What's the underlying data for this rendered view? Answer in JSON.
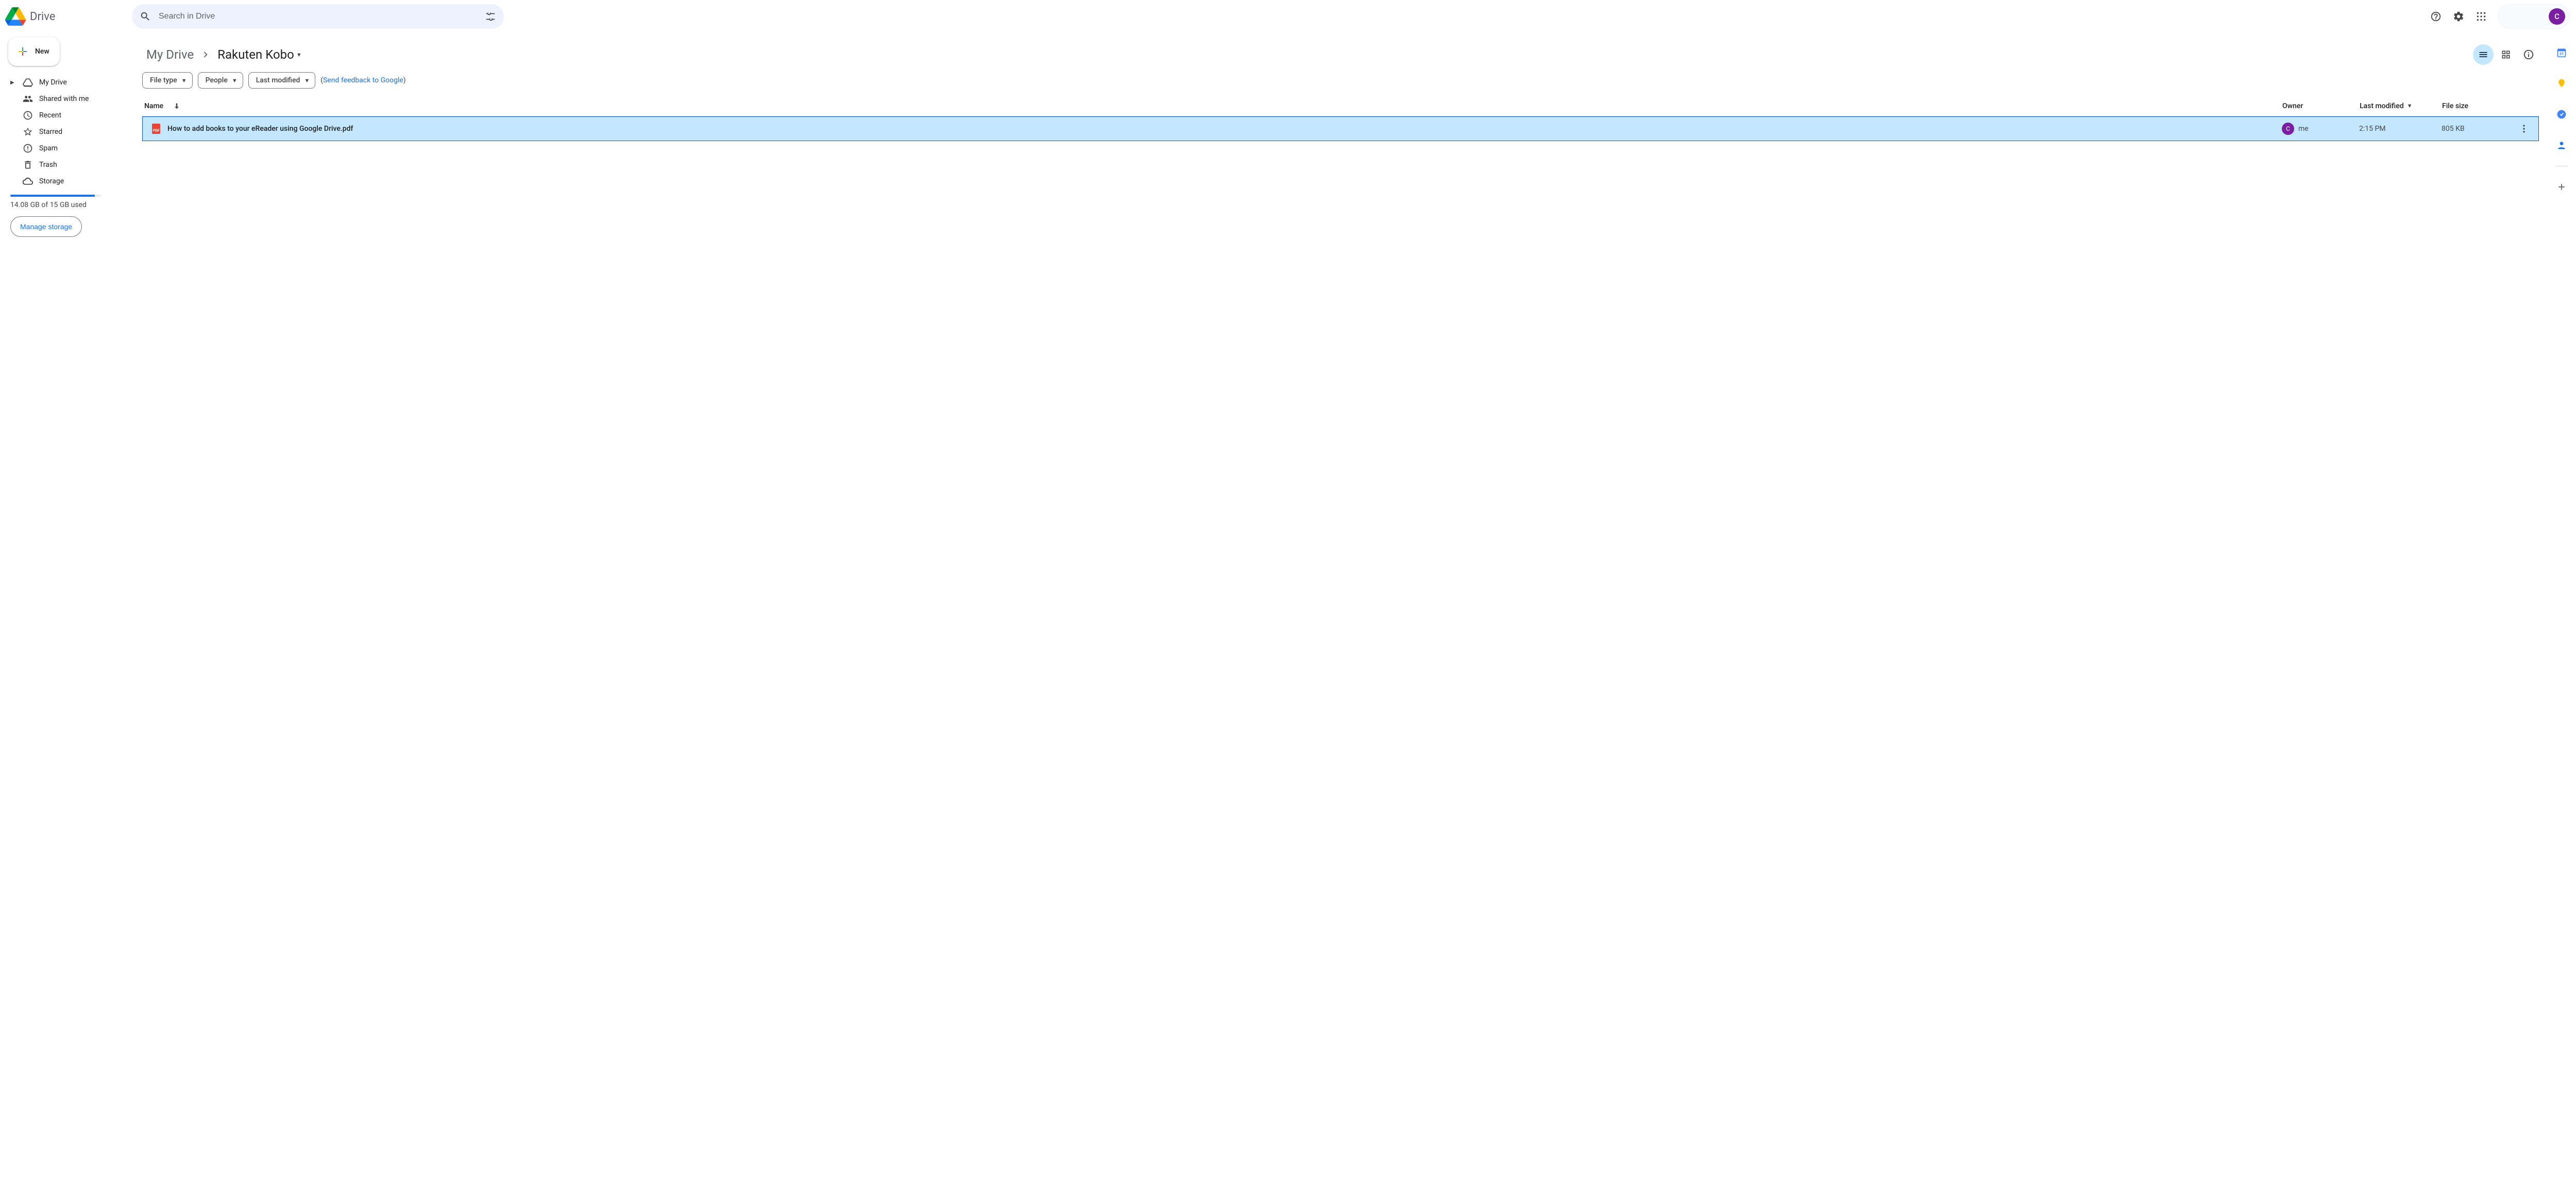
{
  "app": {
    "name": "Drive"
  },
  "search": {
    "placeholder": "Search in Drive"
  },
  "avatar": {
    "initial": "C"
  },
  "sidebar": {
    "new_label": "New",
    "items": [
      {
        "label": "My Drive"
      },
      {
        "label": "Shared with me"
      },
      {
        "label": "Recent"
      },
      {
        "label": "Starred"
      },
      {
        "label": "Spam"
      },
      {
        "label": "Trash"
      },
      {
        "label": "Storage"
      }
    ],
    "storage": {
      "text": "14.08 GB of 15 GB used",
      "percent": 93,
      "manage_label": "Manage storage"
    }
  },
  "breadcrumb": {
    "root": "My Drive",
    "current": "Rakuten Kobo"
  },
  "filters": {
    "file_type": "File type",
    "people": "People",
    "last_modified": "Last modified",
    "feedback_pre": "(",
    "feedback_link": "Send feedback to Google",
    "feedback_post": ")"
  },
  "columns": {
    "name": "Name",
    "owner": "Owner",
    "last_modified": "Last modified",
    "file_size": "File size"
  },
  "files": [
    {
      "icon": "PDF",
      "name": "How to add books to your eReader using Google Drive.pdf",
      "owner": "me",
      "owner_initial": "C",
      "modified": "2:15 PM",
      "size": "805 KB"
    }
  ]
}
